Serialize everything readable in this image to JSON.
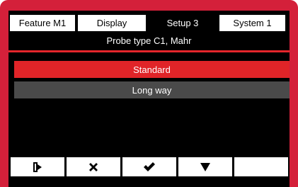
{
  "tabs": [
    {
      "label": "Feature  M1",
      "active": false
    },
    {
      "label": "Display",
      "active": false
    },
    {
      "label": "Setup 3",
      "active": true
    },
    {
      "label": "System 1",
      "active": false
    }
  ],
  "header": {
    "title": "Probe type C1, Mahr"
  },
  "options": [
    {
      "label": "Standard",
      "selected": true
    },
    {
      "label": "Long way",
      "selected": false
    }
  ],
  "softkeys": [
    {
      "icon": "exit-icon"
    },
    {
      "icon": "close-icon"
    },
    {
      "icon": "check-icon"
    },
    {
      "icon": "arrow-down-icon"
    },
    {
      "icon": ""
    }
  ],
  "colors": {
    "bezel": "#d4203a",
    "screen": "#000000",
    "selected_option": "#e02428",
    "unselected_option": "#4a4a4a",
    "rule": "#e5262b"
  }
}
